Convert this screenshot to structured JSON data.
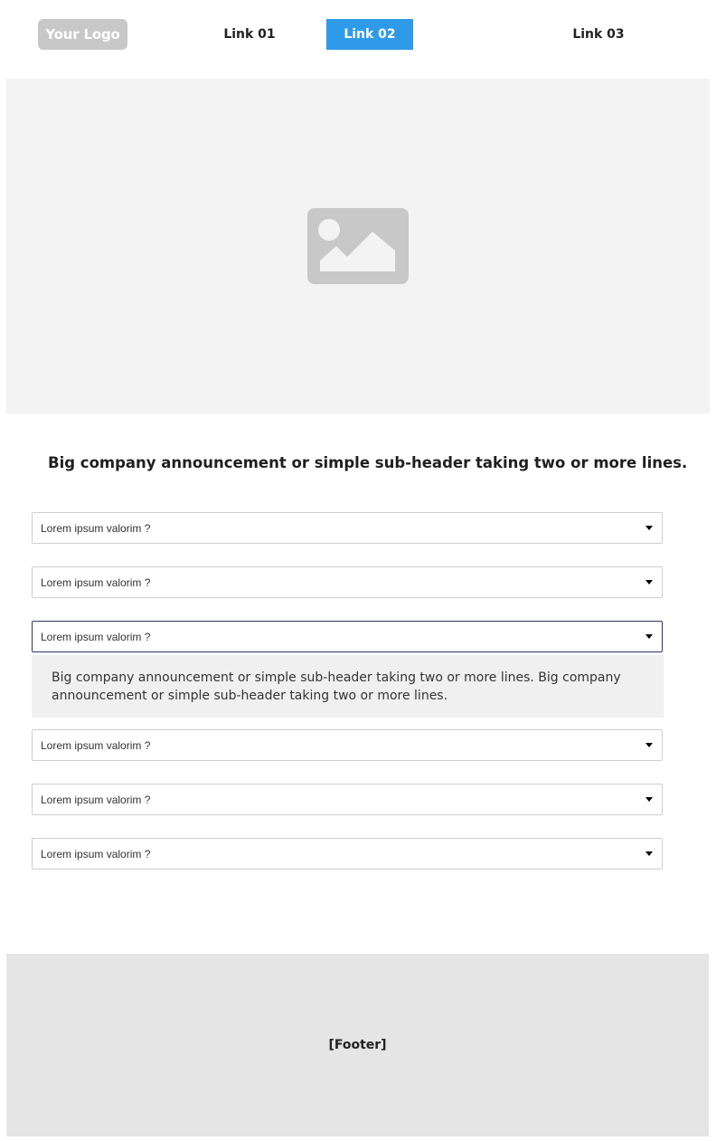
{
  "header": {
    "logo_text": "Your Logo",
    "nav": [
      {
        "label": "Link 01",
        "active": false
      },
      {
        "label": "Link 02",
        "active": true
      },
      {
        "label": "Link 03",
        "active": false
      }
    ]
  },
  "hero": {
    "icon": "image-placeholder-icon"
  },
  "subheader": "Big company announcement or simple sub-header taking two or more lines.",
  "faq": {
    "items": [
      {
        "question": "Lorem ipsum valorim ?",
        "expanded": false
      },
      {
        "question": "Lorem ipsum valorim ?",
        "expanded": false
      },
      {
        "question": "Lorem ipsum valorim ?",
        "expanded": true
      },
      {
        "question": "Lorem ipsum valorim ?",
        "expanded": false
      },
      {
        "question": "Lorem ipsum valorim ?",
        "expanded": false
      },
      {
        "question": "Lorem ipsum valorim ?",
        "expanded": false
      }
    ],
    "answer": "Big company announcement or simple sub-header taking two or more lines. Big company announcement or simple sub-header taking two or more lines.",
    "caret_icon": "caret-down-icon"
  },
  "footer": {
    "label": "[Footer]"
  },
  "colors": {
    "logo_bg": "#c8c8c8",
    "accent": "#2f9be8",
    "hero_bg": "#f3f3f3",
    "placeholder_icon": "#c8c8c8",
    "active_border": "#2b3a67",
    "answer_bg": "#f0f0f0",
    "footer_bg": "#e5e5e5"
  }
}
